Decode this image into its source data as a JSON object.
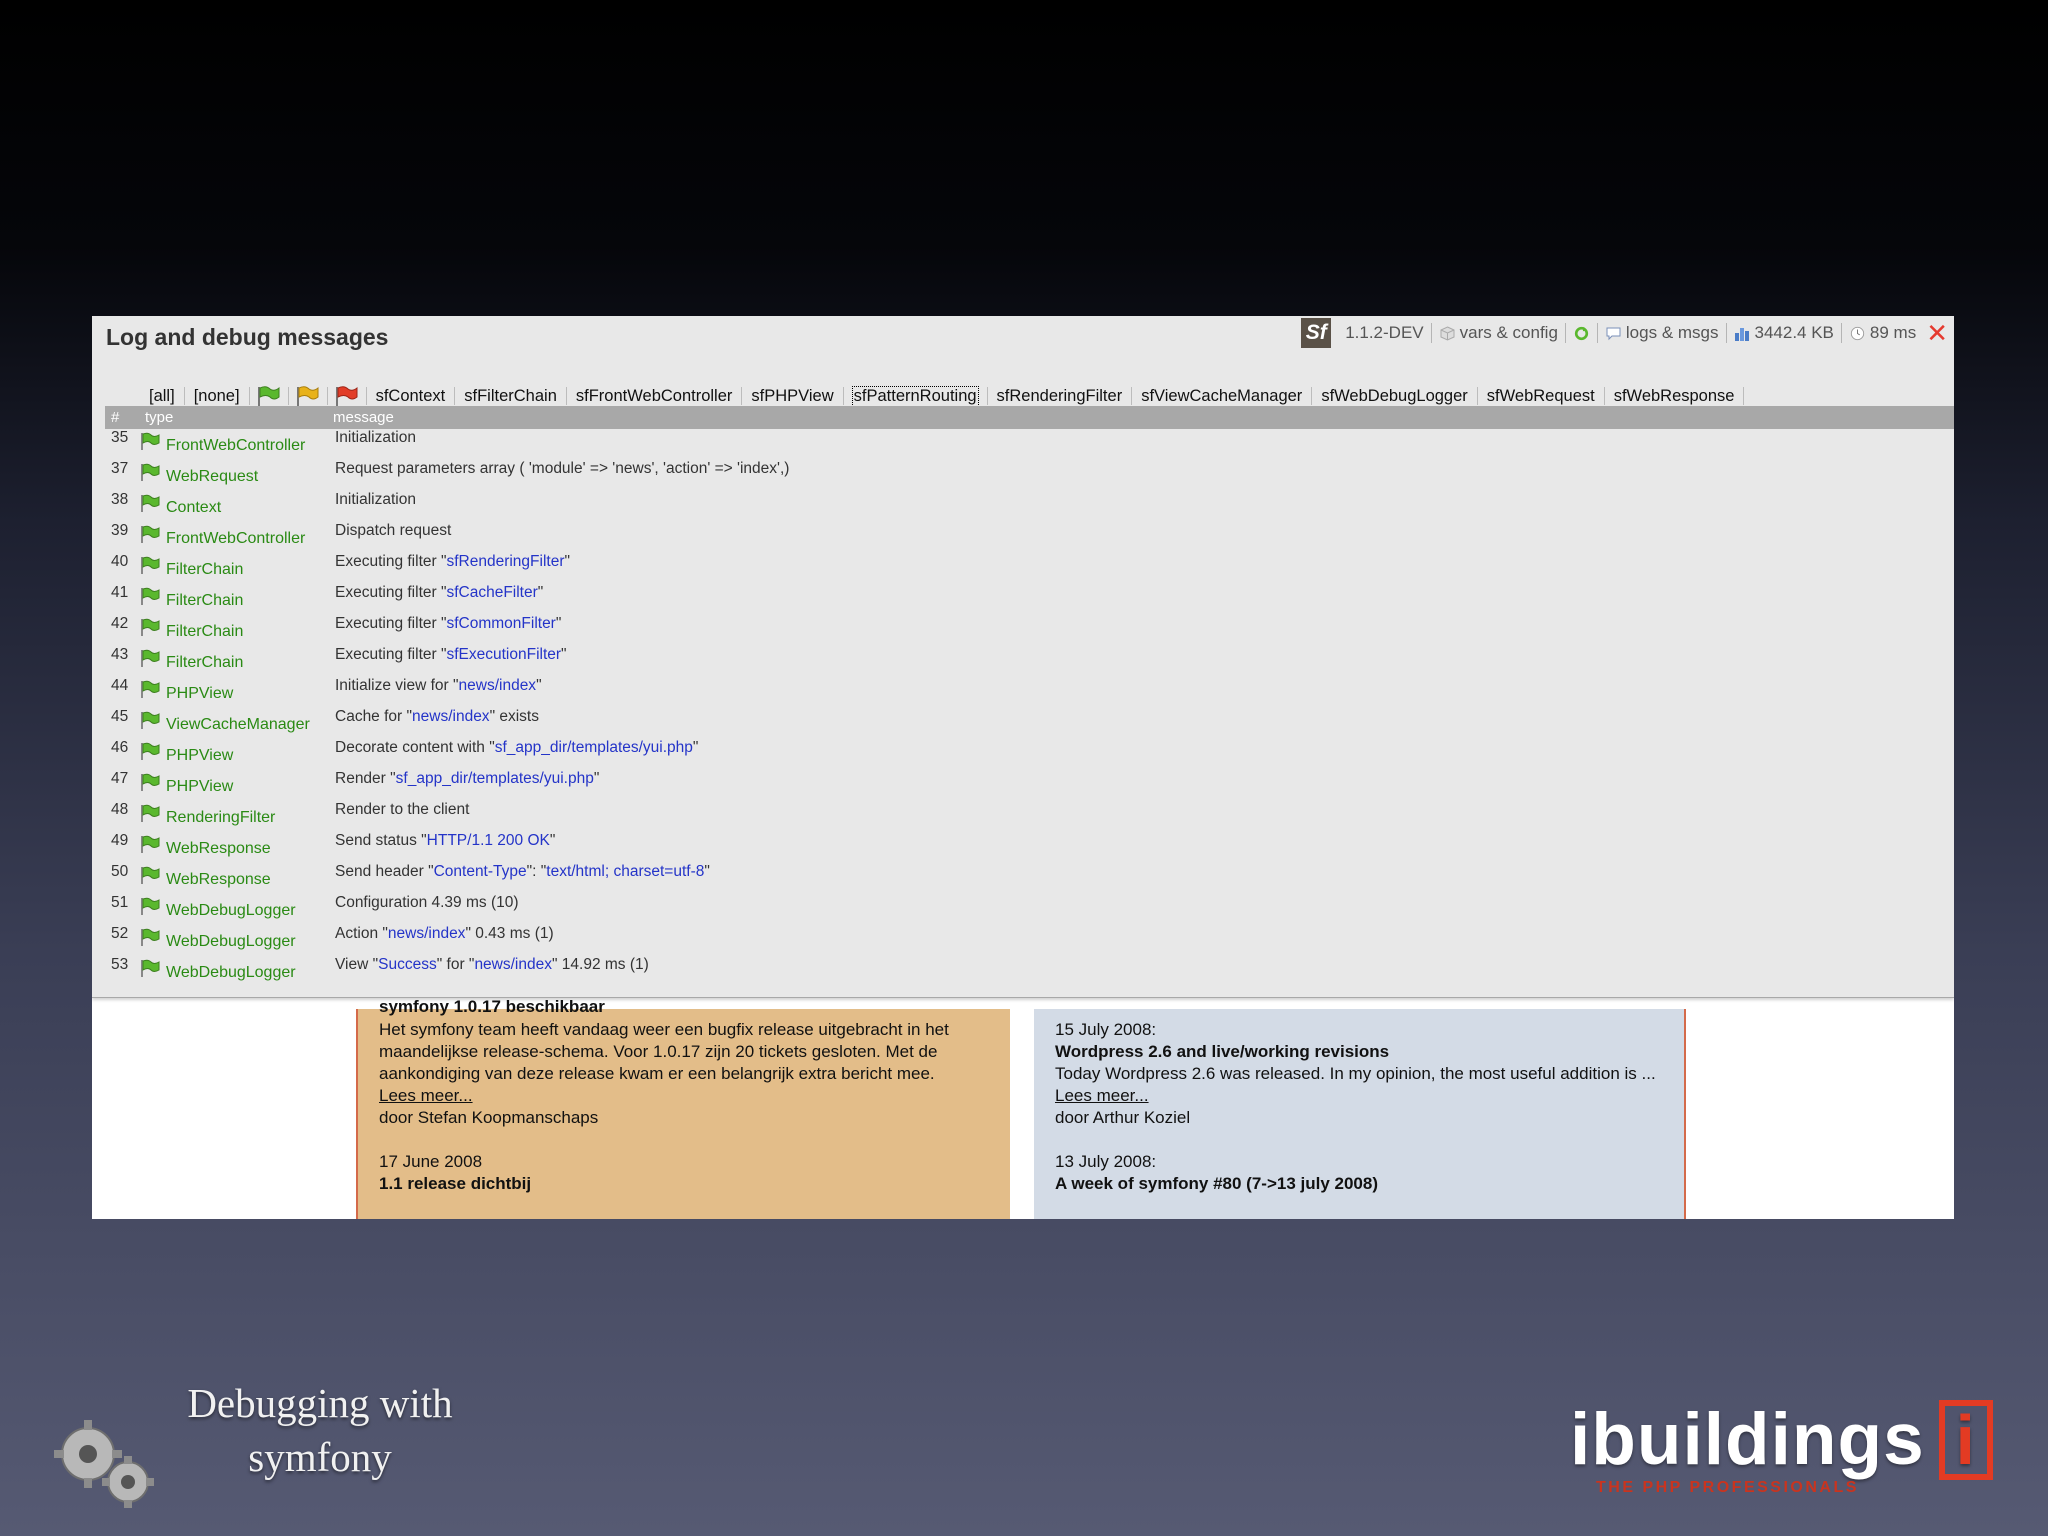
{
  "debug_panel": {
    "title": "Log and debug messages",
    "toolbar": {
      "logo": "Sf",
      "version": "1.1.2-DEV",
      "vars_config": "vars & config",
      "logs_msgs": "logs & msgs",
      "memory": "3442.4 KB",
      "time": "89 ms",
      "close": "✕"
    },
    "filters": {
      "all": "[all]",
      "none": "[none]",
      "flag_colors": [
        "#5ab82e",
        "#e8b21a",
        "#e23d28"
      ],
      "tabs": [
        "sfContext",
        "sfFilterChain",
        "sfFrontWebController",
        "sfPHPView",
        "sfPatternRouting",
        "sfRenderingFilter",
        "sfViewCacheManager",
        "sfWebDebugLogger",
        "sfWebRequest",
        "sfWebResponse"
      ],
      "active_tab": "sfPatternRouting"
    },
    "columns": {
      "num": "#",
      "type": "type",
      "message": "message"
    },
    "rows": [
      {
        "num": "35",
        "type": "FrontWebController",
        "message": [
          {
            "t": "Initialization"
          }
        ]
      },
      {
        "num": "37",
        "type": "WebRequest",
        "message": [
          {
            "t": "Request parameters array ( 'module' => 'news', 'action' => 'index',)"
          }
        ]
      },
      {
        "num": "38",
        "type": "Context",
        "message": [
          {
            "t": "Initialization"
          }
        ]
      },
      {
        "num": "39",
        "type": "FrontWebController",
        "message": [
          {
            "t": "Dispatch request"
          }
        ]
      },
      {
        "num": "40",
        "type": "FilterChain",
        "message": [
          {
            "t": "Executing filter \""
          },
          {
            "t": "sfRenderingFilter",
            "h": true
          },
          {
            "t": "\""
          }
        ]
      },
      {
        "num": "41",
        "type": "FilterChain",
        "message": [
          {
            "t": "Executing filter \""
          },
          {
            "t": "sfCacheFilter",
            "h": true
          },
          {
            "t": "\""
          }
        ]
      },
      {
        "num": "42",
        "type": "FilterChain",
        "message": [
          {
            "t": "Executing filter \""
          },
          {
            "t": "sfCommonFilter",
            "h": true
          },
          {
            "t": "\""
          }
        ]
      },
      {
        "num": "43",
        "type": "FilterChain",
        "message": [
          {
            "t": "Executing filter \""
          },
          {
            "t": "sfExecutionFilter",
            "h": true
          },
          {
            "t": "\""
          }
        ]
      },
      {
        "num": "44",
        "type": "PHPView",
        "message": [
          {
            "t": "Initialize view for \""
          },
          {
            "t": "news/index",
            "h": true
          },
          {
            "t": "\""
          }
        ]
      },
      {
        "num": "45",
        "type": "ViewCacheManager",
        "message": [
          {
            "t": "Cache for \""
          },
          {
            "t": "news/index",
            "h": true
          },
          {
            "t": "\" exists"
          }
        ]
      },
      {
        "num": "46",
        "type": "PHPView",
        "message": [
          {
            "t": "Decorate content with \""
          },
          {
            "t": "sf_app_dir/templates/yui.php",
            "h": true
          },
          {
            "t": "\""
          }
        ]
      },
      {
        "num": "47",
        "type": "PHPView",
        "message": [
          {
            "t": "Render \""
          },
          {
            "t": "sf_app_dir/templates/yui.php",
            "h": true
          },
          {
            "t": "\""
          }
        ]
      },
      {
        "num": "48",
        "type": "RenderingFilter",
        "message": [
          {
            "t": "Render to the client"
          }
        ]
      },
      {
        "num": "49",
        "type": "WebResponse",
        "message": [
          {
            "t": "Send status \""
          },
          {
            "t": "HTTP/1.1 200 OK",
            "h": true
          },
          {
            "t": "\""
          }
        ]
      },
      {
        "num": "50",
        "type": "WebResponse",
        "message": [
          {
            "t": "Send header \""
          },
          {
            "t": "Content-Type",
            "h": true
          },
          {
            "t": "\": \""
          },
          {
            "t": "text/html; charset=utf-8",
            "h": true
          },
          {
            "t": "\""
          }
        ]
      },
      {
        "num": "51",
        "type": "WebDebugLogger",
        "message": [
          {
            "t": "Configuration 4.39 ms (10)"
          }
        ]
      },
      {
        "num": "52",
        "type": "WebDebugLogger",
        "message": [
          {
            "t": "Action \""
          },
          {
            "t": "news/index",
            "h": true
          },
          {
            "t": "\" 0.43 ms (1)"
          }
        ]
      },
      {
        "num": "53",
        "type": "WebDebugLogger",
        "message": [
          {
            "t": "View \""
          },
          {
            "t": "Success",
            "h": true
          },
          {
            "t": "\" for \""
          },
          {
            "t": "news/index",
            "h": true
          },
          {
            "t": "\" 14.92 ms (1)"
          }
        ]
      }
    ]
  },
  "page": {
    "left": {
      "cut_heading": "symfony 1.0.17 beschikbaar",
      "body": "Het symfony team heeft vandaag weer een bugfix release uitgebracht in het maandelijkse release-schema. Voor 1.0.17 zijn 20 tickets gesloten. Met de aankondiging van deze release kwam er een belangrijk extra bericht mee.",
      "read_more": "Lees meer...",
      "author": "door Stefan Koopmanschaps",
      "date2": "17 June 2008",
      "heading2": "1.1 release dichtbij"
    },
    "right": {
      "date1": "15 July 2008:",
      "heading1": "Wordpress 2.6 and live/working revisions",
      "body": "Today Wordpress 2.6 was released. In my opinion, the most useful addition is ...",
      "read_more": "Lees meer...",
      "author": "door Arthur Koziel",
      "date2": "13 July 2008:",
      "heading2": "A week of symfony #80 (7->13 july 2008)"
    }
  },
  "slide": {
    "title_line1": "Debugging with",
    "title_line2": "symfony",
    "brand": "ibuildings",
    "brand_box": "i",
    "tagline": "THE PHP PROFESSIONALS",
    "accent": "#e33b23"
  }
}
